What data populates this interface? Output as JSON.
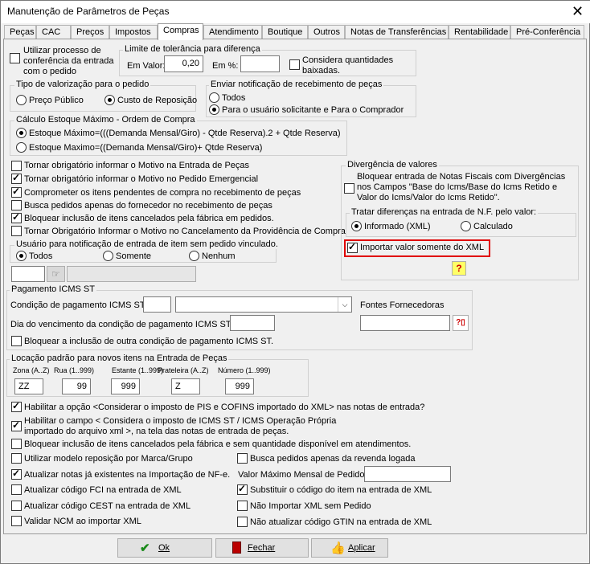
{
  "window": {
    "title": "Manutenção de Parâmetros de Peças",
    "close_glyph": "✕"
  },
  "tabs": [
    "Peças",
    "CAC",
    "Preços",
    "Impostos",
    "Compras",
    "Atendimento",
    "Boutique",
    "Outros",
    "Notas de Transferências",
    "Rentabilidade",
    "Pré-Conferência"
  ],
  "active_tab": "Compras",
  "conferencia": {
    "label": "Utilizar processo de conferência da entrada com o pedido",
    "checked": false
  },
  "tolerancia": {
    "title": "Limite de tolerância para diferença",
    "valor_label": "Em Valor:",
    "valor_value": "0,20",
    "pct_label": "Em %:",
    "pct_value": "",
    "baixadas_label": "Considera quantidades baixadas.",
    "baixadas_checked": false
  },
  "valorizacao": {
    "title": "Tipo de valorização para o pedido",
    "options": [
      "Preço Público",
      "Custo de Reposição"
    ],
    "selected": 1
  },
  "notificacao": {
    "title": "Enviar notificação de recebimento de peças",
    "options": [
      "Todos",
      "Para o usuário solicitante e Para o Comprador"
    ],
    "selected": 1
  },
  "estoque": {
    "title": "Cálculo Estoque Máximo - Ordem de Compra",
    "options": [
      "Estoque Máximo=(((Demanda Mensal/Giro) - Qtde Reserva).2 + Qtde Reserva)",
      "Estoque Maximo=((Demanda Mensal/Giro)+ Qtde Reserva)"
    ],
    "selected": 0
  },
  "checks_left": [
    {
      "label": "Tornar obrigatório informar o Motivo na Entrada de Peças",
      "checked": false
    },
    {
      "label": "Tornar obrigatório informar o Motivo no Pedido Emergencial",
      "checked": true
    },
    {
      "label": "Comprometer os itens pendentes de compra no recebimento de peças",
      "checked": true
    },
    {
      "label": "Busca pedidos apenas do fornecedor no recebimento de peças",
      "checked": false
    },
    {
      "label": "Bloquear inclusão de itens cancelados pela fábrica em pedidos.",
      "checked": true
    },
    {
      "label": "Tornar Obrigatório Informar o Motivo no Cancelamento da Providência de Compra",
      "checked": false
    }
  ],
  "usuario_notif": {
    "title": "Usuário para notificação de entrada de item sem pedido vinculado.",
    "options": [
      "Todos",
      "Somente",
      "Nenhum"
    ],
    "selected": 0
  },
  "divergencia": {
    "title": "Divergência de valores",
    "bloquear_label": "Bloquear entrada de Notas Fiscais com Divergências nos Campos \"Base do Icms/Base do Icms Retido e Valor do Icms/Valor do Icms Retido\".",
    "bloquear_checked": false,
    "tratar_title": "Tratar diferenças na entrada de N.F. pelo valor:",
    "tratar_options": [
      "Informado (XML)",
      "Calculado"
    ],
    "tratar_selected": 0,
    "importar_label": "Importar valor somente do XML",
    "importar_checked": true
  },
  "icms_st": {
    "title": "Pagamento ICMS ST",
    "condicao_label": "Condição de pagamento ICMS ST",
    "fontes_label": "Fontes Fornecedoras",
    "vencimento_label": "Dia do vencimento da condição de pagamento ICMS ST.",
    "bloquear_label": "Bloquear a inclusão de outra condição de pagamento ICMS ST.",
    "bloquear_checked": false
  },
  "locacao": {
    "title": "Locação padrão para novos itens na Entrada de Peças",
    "fields": [
      {
        "label": "Zona (A..Z)",
        "value": "ZZ"
      },
      {
        "label": "Rua (1..999)",
        "value": "99"
      },
      {
        "label": "Estante (1..999)",
        "value": "999"
      },
      {
        "label": "Prateleira (A..Z)",
        "value": "Z"
      },
      {
        "label": "Número (1..999)",
        "value": "999"
      }
    ]
  },
  "bottom_checks": [
    {
      "label": "Habilitar a opção <Considerar o imposto de PIS e COFINS importado do XML> nas notas de entrada?",
      "checked": true
    },
    {
      "label": "Habilitar o campo < Considera o imposto de ICMS ST / ICMS Operação Própria",
      "label2": "importado do arquivo xml >, na tela das notas de entrada de peças.",
      "checked": true
    },
    {
      "label": "Bloquear inclusão de itens cancelados pela fábrica e sem quantidade disponível em atendimentos.",
      "checked": false
    }
  ],
  "grid_left": [
    {
      "label": "Utilizar modelo reposição por Marca/Grupo",
      "checked": false
    },
    {
      "label": "Atualizar notas já existentes na Importação de NF-e.",
      "checked": true
    },
    {
      "label": "Atualizar código FCI na entrada de XML",
      "checked": false
    },
    {
      "label": "Atualizar código CEST na entrada de XML",
      "checked": false
    },
    {
      "label": "Validar NCM ao importar XML",
      "checked": false
    }
  ],
  "grid_right": {
    "busca": {
      "label": "Busca pedidos apenas da revenda logada",
      "checked": false
    },
    "valor_max_label": "Valor Máximo Mensal de Pedidos",
    "checks": [
      {
        "label": "Substituir o código do item na entrada de XML",
        "checked": true
      },
      {
        "label": "Não Importar XML sem Pedido",
        "checked": false
      },
      {
        "label": "Não atualizar código GTIN na entrada de XML",
        "checked": false
      }
    ]
  },
  "buttons": {
    "ok": "Ok",
    "fechar": "Fechar",
    "aplicar": "Aplicar"
  },
  "colors": {
    "highlight": "#e00000",
    "ok_icon": "#1a8a1a"
  }
}
